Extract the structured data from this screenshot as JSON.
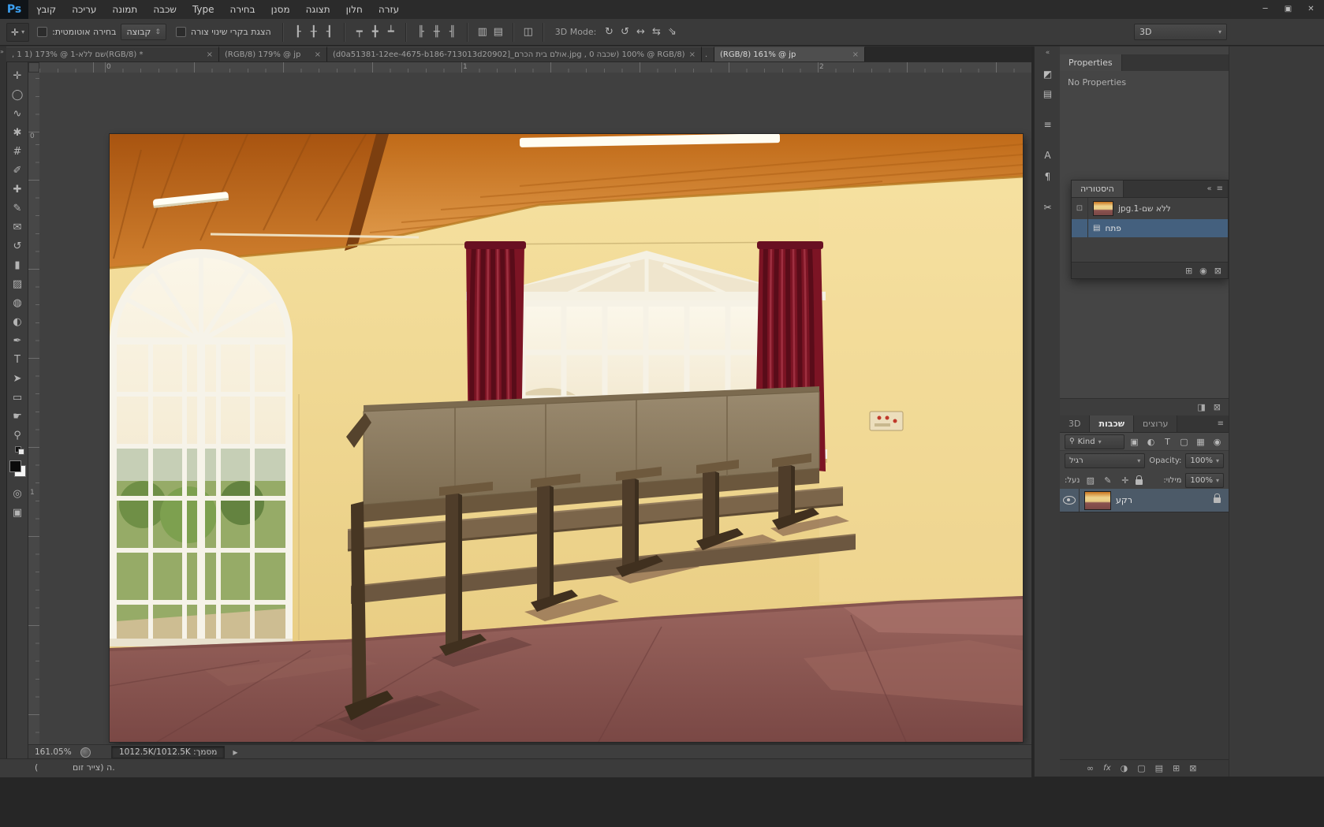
{
  "colors": {
    "wall": "#eed28c",
    "carpet": "#8a5350",
    "curtain": "#7c1424",
    "ceiling_wood": "#c9741f",
    "bench_wood": "#6b573d",
    "selection_blue": "#44607e"
  },
  "window_controls": {
    "minimize": "─",
    "maximize": "▣",
    "close": "✕"
  },
  "menu_bar": {
    "logo": "Ps",
    "items": [
      "קובץ",
      "עריכה",
      "תמונה",
      "שכבה",
      "Type",
      "בחירה",
      "מסנן",
      "תצוגה",
      "חלון",
      "עזרה"
    ]
  },
  "options_bar": {
    "tool_glyph": "✛",
    "tool_caret": "▾",
    "auto_select_label": "בחירה אוטומטית:",
    "group_value": "קבוצה",
    "group_stepper": "⇕",
    "show_transform_label": "הצגת בקרי שינוי צורה",
    "align_group1": [
      {
        "name": "align-left-edges",
        "glyph": "┠"
      },
      {
        "name": "align-horizontal-centers",
        "glyph": "╂"
      },
      {
        "name": "align-right-edges",
        "glyph": "┨"
      }
    ],
    "align_group2": [
      {
        "name": "align-top-edges",
        "glyph": "┯"
      },
      {
        "name": "align-vertical-centers",
        "glyph": "╋"
      },
      {
        "name": "align-bottom-edges",
        "glyph": "┷"
      }
    ],
    "align_group3": [
      {
        "name": "distribute-left-edges",
        "glyph": "╟"
      },
      {
        "name": "distribute-centers",
        "glyph": "╫"
      },
      {
        "name": "distribute-right-edges",
        "glyph": "╢"
      }
    ],
    "align_group4": [
      {
        "name": "auto-align-layers",
        "glyph": "▥"
      },
      {
        "name": "auto-blend-layers",
        "glyph": "▤"
      }
    ],
    "align_group5": [
      {
        "name": "arrange",
        "glyph": "◫"
      }
    ],
    "mode3d_label": "3D Mode:",
    "mode3d_icons": [
      {
        "name": "3d-rotate",
        "glyph": "↻"
      },
      {
        "name": "3d-roll",
        "glyph": "↺"
      },
      {
        "name": "3d-drag",
        "glyph": "↔"
      },
      {
        "name": "3d-slide",
        "glyph": "⇆"
      },
      {
        "name": "3d-scale",
        "glyph": "⇘"
      }
    ],
    "workspace": "3D",
    "workspace_caret": "▾"
  },
  "tab_bar": {
    "collapse": "»",
    "tabs": [
      {
        "label": ", 1 1) 173% @ 1-שם ללא(RGB/8) *",
        "close": "×"
      },
      {
        "label": "(RGB/8) 179% @ jp",
        "close": "×"
      },
      {
        "label": "(d0a51381-12ee-4675-b186-713013d20902]_אולם בית הכרם.jpg , 0 שכבה) 100% @ RGB/8) *",
        "close": "×"
      },
      {
        "label": ".",
        "close": ""
      },
      {
        "label": "(RGB/8) 161% @ jp",
        "close": "×"
      }
    ]
  },
  "toolbar": {
    "tools": [
      {
        "name": "move-tool",
        "glyph": "✛"
      },
      {
        "name": "marquee-tool",
        "glyph": "◯"
      },
      {
        "name": "lasso-tool",
        "glyph": "∿"
      },
      {
        "name": "quick-selection-tool",
        "glyph": "✱"
      },
      {
        "name": "crop-tool",
        "glyph": "#"
      },
      {
        "name": "eyedropper-tool",
        "glyph": "✐"
      },
      {
        "name": "healing-brush-tool",
        "glyph": "✚"
      },
      {
        "name": "brush-tool",
        "glyph": "✎"
      },
      {
        "name": "clone-stamp-tool",
        "glyph": "✉"
      },
      {
        "name": "history-brush-tool",
        "glyph": "↺"
      },
      {
        "name": "eraser-tool",
        "glyph": "▮"
      },
      {
        "name": "gradient-tool",
        "glyph": "▨"
      },
      {
        "name": "blur-tool",
        "glyph": "◍"
      },
      {
        "name": "dodge-tool",
        "glyph": "◐"
      },
      {
        "name": "pen-tool",
        "glyph": "✒"
      },
      {
        "name": "type-tool",
        "glyph": "T"
      },
      {
        "name": "path-selection-tool",
        "glyph": "➤"
      },
      {
        "name": "shape-tool",
        "glyph": "▭"
      },
      {
        "name": "hand-tool",
        "glyph": "☛"
      },
      {
        "name": "zoom-tool",
        "glyph": "⚲"
      }
    ],
    "quick_mask_glyph": "◎",
    "screen_mode_glyph": "▣"
  },
  "rulers": {
    "top_labels": [
      "0",
      "1",
      "2"
    ],
    "left_labels": [
      "0",
      "1"
    ]
  },
  "status_bar": {
    "zoom": "161.05%",
    "doc_label": "מסמך:",
    "doc_value": "1012.5K/1012.5K",
    "expander": "▶"
  },
  "hint_bar": {
    "paren": "(",
    "text": "ה (צייר זום."
  },
  "dock": {
    "collapse": "«",
    "icon_strip": [
      {
        "name": "dock-panel-icon-1",
        "glyph": "◩"
      },
      {
        "name": "dock-panel-icon-2",
        "glyph": "▤"
      },
      {
        "name": "dock-panel-icon-adjustments",
        "glyph": "≡"
      },
      {
        "name": "dock-panel-icon-character",
        "glyph": "A"
      },
      {
        "name": "dock-panel-icon-paragraph",
        "glyph": "¶"
      },
      {
        "name": "dock-panel-icon-6",
        "glyph": "✂"
      }
    ],
    "properties": {
      "tab": "Properties",
      "empty_text": "No Properties",
      "footer_icons": [
        {
          "name": "properties-footer-icon-1",
          "glyph": "◨"
        },
        {
          "name": "properties-footer-icon-2",
          "glyph": "⊠"
        }
      ]
    },
    "history": {
      "tab": "היסטוריה",
      "collapse": "«",
      "menu": "≡",
      "source_glyph": "⊡",
      "doc_glyph": "▤",
      "entries": [
        {
          "label": "ללא שם-1.jpg"
        },
        {
          "label": "פתח"
        }
      ],
      "buttons": [
        {
          "name": "new-document-from-state",
          "glyph": "⊞"
        },
        {
          "name": "new-snapshot",
          "glyph": "◉"
        },
        {
          "name": "delete-state",
          "glyph": "⊠"
        }
      ]
    },
    "layers": {
      "tabs": [
        "3D",
        "שכבות",
        "ערוצים"
      ],
      "menu": "≡",
      "filter_search": "⚲",
      "filter_label": "Kind",
      "caret": "▾",
      "filter_icons": [
        {
          "name": "filter-pixel-layers",
          "glyph": "▣"
        },
        {
          "name": "filter-adjustment-layers",
          "glyph": "◐"
        },
        {
          "name": "filter-type-layers",
          "glyph": "T"
        },
        {
          "name": "filter-shape-layers",
          "glyph": "▢"
        },
        {
          "name": "filter-smart-objects",
          "glyph": "▦"
        }
      ],
      "filter_toggle": "◉",
      "blend_mode": "רגיל",
      "opacity_label": "Opacity:",
      "opacity_value": "100%",
      "lock_label": "נעל:",
      "lock_icons": [
        {
          "name": "lock-transparency",
          "glyph": "▨"
        },
        {
          "name": "lock-paint",
          "glyph": "✎"
        },
        {
          "name": "lock-position",
          "glyph": "✛"
        }
      ],
      "fill_label": "מילוי:",
      "fill_value": "100%",
      "rows": [
        {
          "name": "רקע"
        }
      ],
      "footer_icons": [
        {
          "name": "link-layers",
          "glyph": "∞"
        },
        {
          "name": "layer-style",
          "glyph": "fx"
        },
        {
          "name": "adjustment-layer",
          "glyph": "◑"
        },
        {
          "name": "layer-mask",
          "glyph": "▢"
        },
        {
          "name": "new-group",
          "glyph": "▤"
        },
        {
          "name": "new-layer",
          "glyph": "⊞"
        },
        {
          "name": "delete-layer",
          "glyph": "⊠"
        }
      ]
    }
  }
}
